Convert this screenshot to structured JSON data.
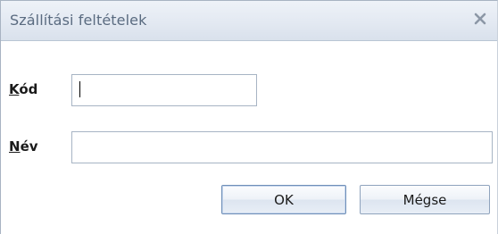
{
  "dialog": {
    "title": "Szállítási feltételek",
    "close_icon": "close-icon"
  },
  "form": {
    "code": {
      "label_accel": "K",
      "label_rest": "ód",
      "value": ""
    },
    "name": {
      "label_accel": "N",
      "label_rest": "év",
      "value": ""
    }
  },
  "buttons": {
    "ok_label": "OK",
    "cancel_label": "Mégse"
  },
  "colors": {
    "title_text": "#5a6b80",
    "border": "#a7b4c4"
  }
}
